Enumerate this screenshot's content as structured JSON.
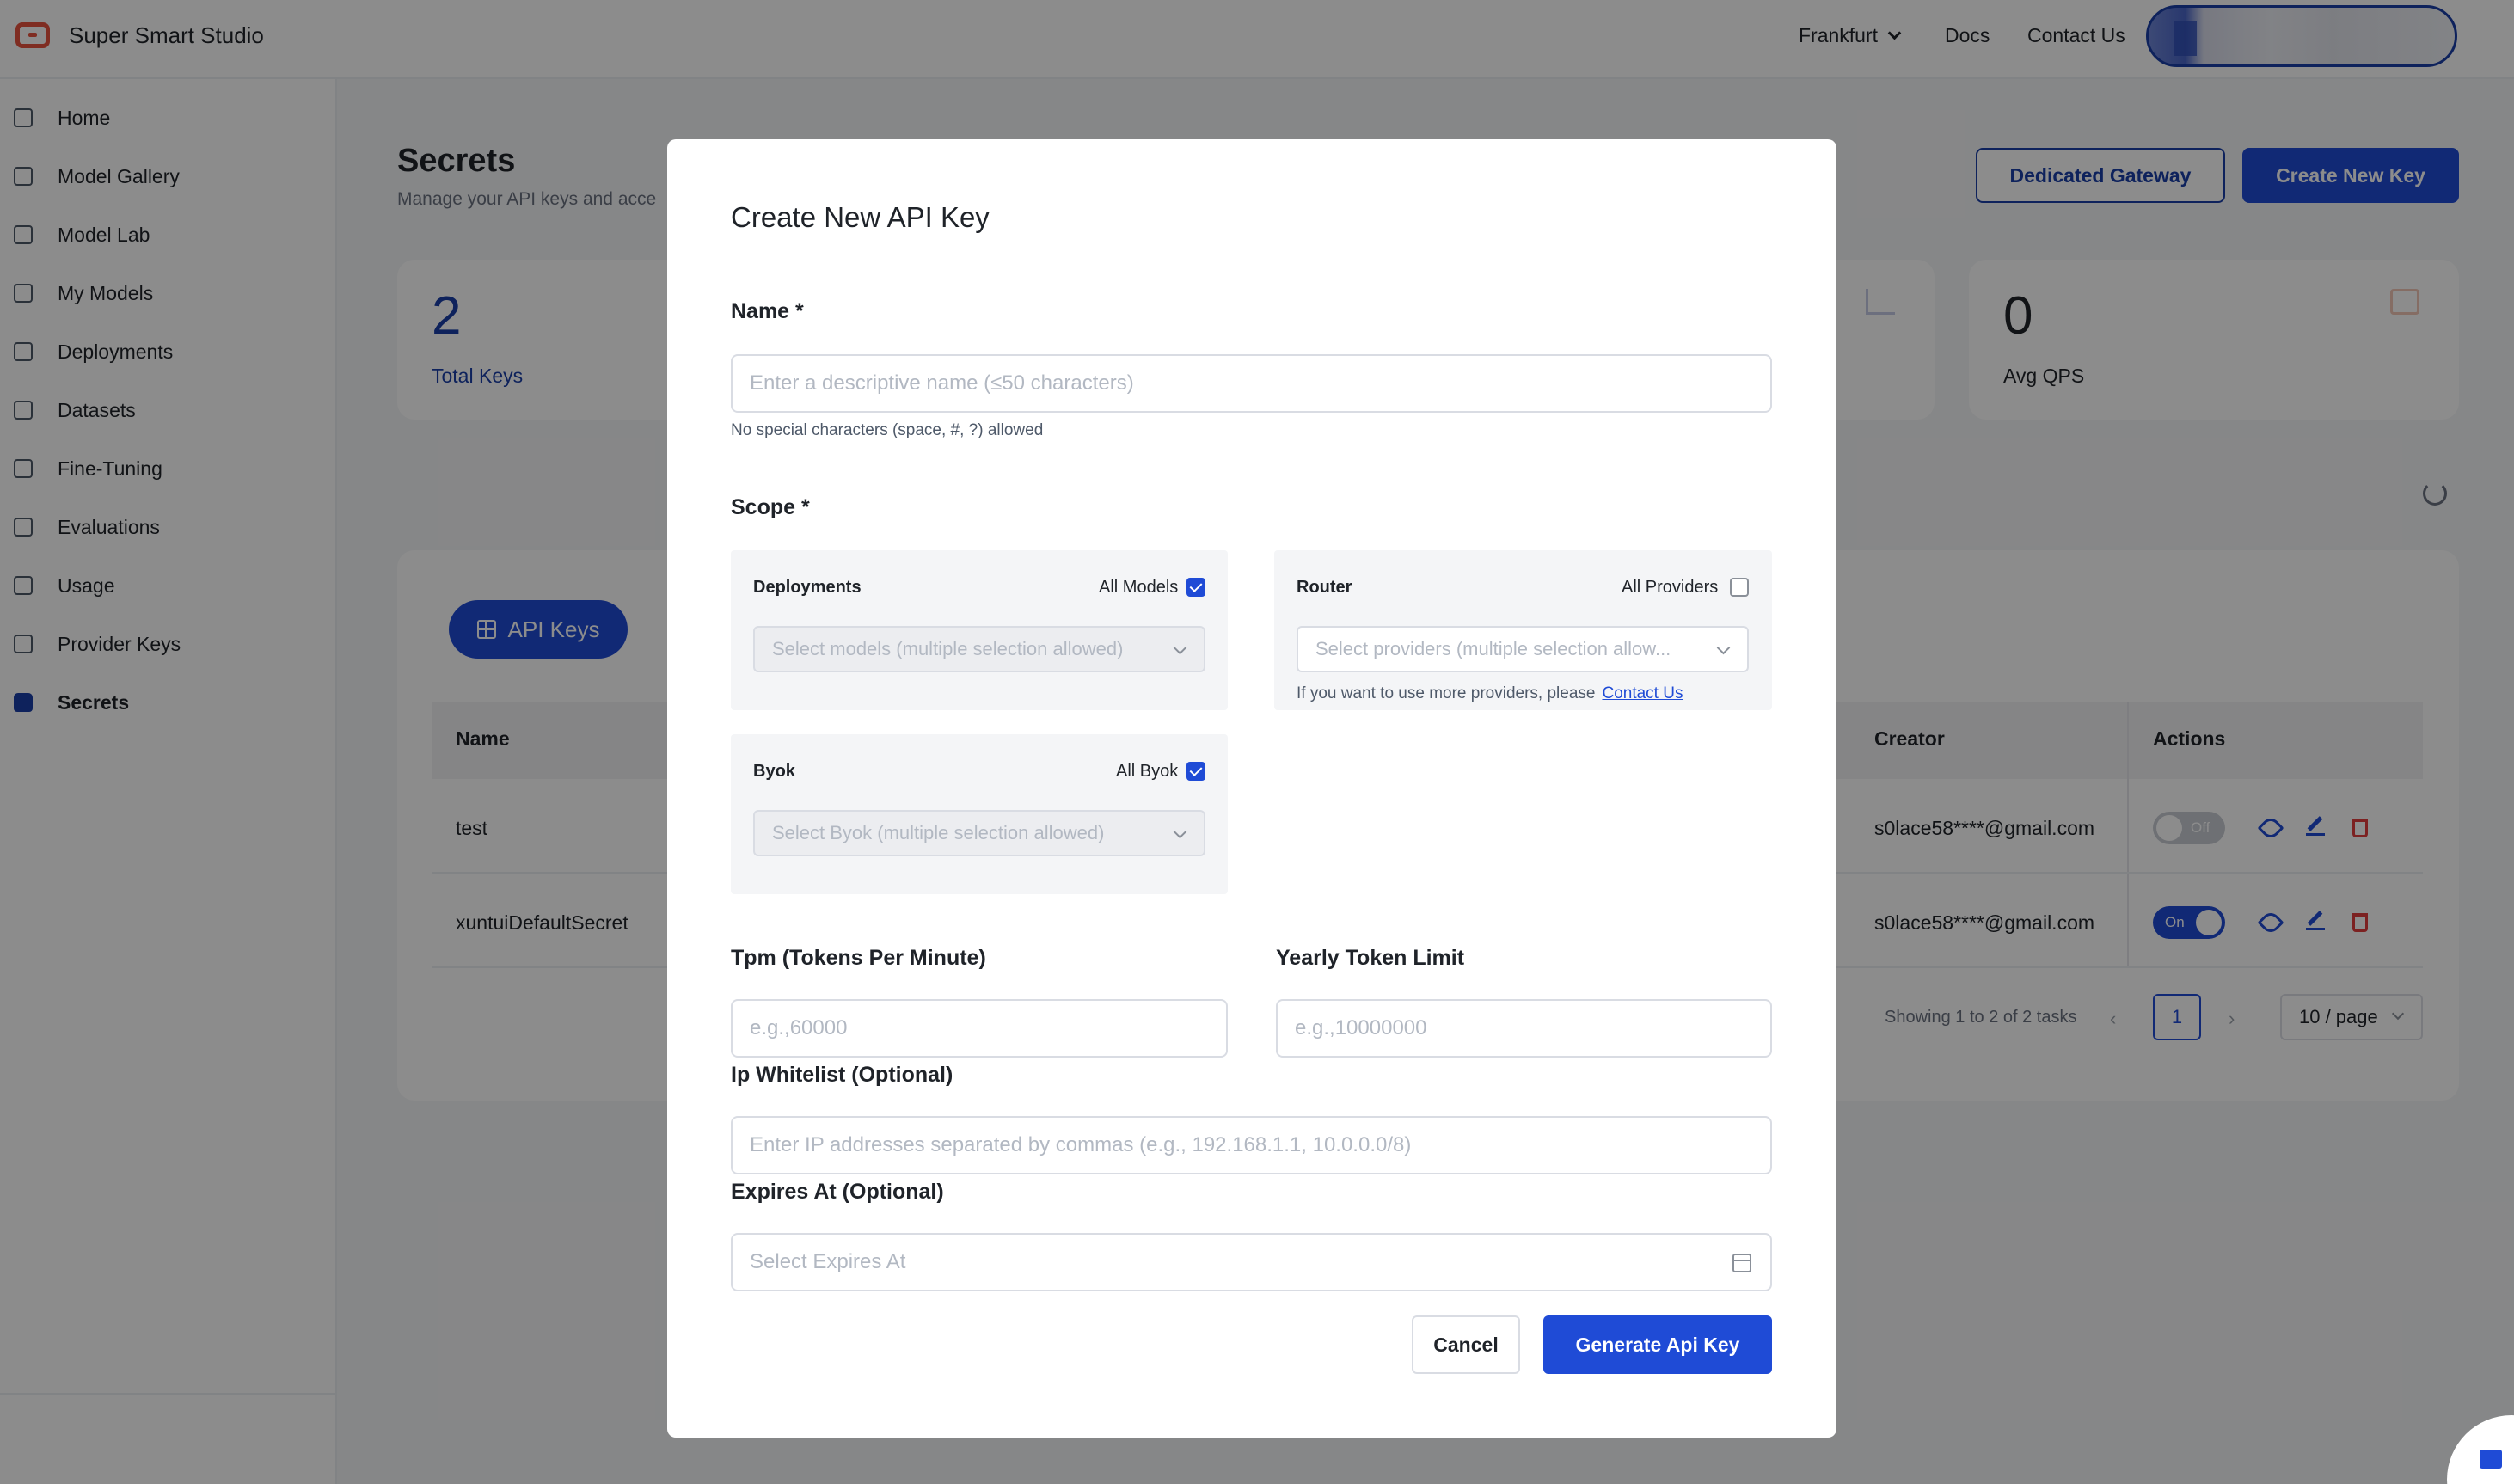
{
  "app": {
    "title": "Super Smart Studio"
  },
  "header": {
    "region": "Frankfurt",
    "docs": "Docs",
    "contact": "Contact Us"
  },
  "sidebar": {
    "items": [
      {
        "label": "Home",
        "icon": "home-icon"
      },
      {
        "label": "Model Gallery",
        "icon": "gallery-icon"
      },
      {
        "label": "Model Lab",
        "icon": "lab-icon"
      },
      {
        "label": "My Models",
        "icon": "models-icon"
      },
      {
        "label": "Deployments",
        "icon": "deployments-icon"
      },
      {
        "label": "Datasets",
        "icon": "datasets-icon"
      },
      {
        "label": "Fine-Tuning",
        "icon": "sliders-icon"
      },
      {
        "label": "Evaluations",
        "icon": "pencil-icon"
      },
      {
        "label": "Usage",
        "icon": "chart-icon"
      },
      {
        "label": "Provider Keys",
        "icon": "key-icon"
      },
      {
        "label": "Secrets",
        "icon": "lock-icon",
        "active": true
      }
    ]
  },
  "page": {
    "title": "Secrets",
    "subtitle": "Manage your API keys and acce",
    "dedicated_gateway": "Dedicated Gateway",
    "create_new_key": "Create New Key",
    "stats": {
      "total_keys_value": "2",
      "total_keys_label": "Total Keys",
      "avg_qps_value": "0",
      "avg_qps_label": "Avg QPS"
    },
    "tab": "API Keys",
    "table": {
      "headers": {
        "name": "Name",
        "creator": "Creator",
        "actions": "Actions"
      },
      "rows": [
        {
          "name": "test",
          "creator": "s0lace58****@gmail.com",
          "toggle": "Off"
        },
        {
          "name": "xuntuiDefaultSecret",
          "creator": "s0lace58****@gmail.com",
          "toggle": "On"
        }
      ]
    },
    "pager": {
      "showing": "Showing 1 to 2 of 2 tasks",
      "current_page": "1",
      "page_size": "10 / page"
    }
  },
  "modal": {
    "title": "Create New API Key",
    "name_label": "Name *",
    "name_placeholder": "Enter a descriptive name (≤50 characters)",
    "name_hint": "No special characters (space, #, ?) allowed",
    "scope_label": "Scope *",
    "deployments": {
      "title": "Deployments",
      "check_label": "All Models",
      "checked": true,
      "placeholder": "Select models (multiple selection allowed)"
    },
    "router": {
      "title": "Router",
      "check_label": "All Providers",
      "checked": false,
      "placeholder": "Select providers (multiple selection allow...",
      "note": "If you want to use more providers, please",
      "note_link": "Contact Us"
    },
    "byok": {
      "title": "Byok",
      "check_label": "All Byok",
      "checked": true,
      "placeholder": "Select Byok (multiple selection allowed)"
    },
    "tpm_label": "Tpm (Tokens Per Minute)",
    "tpm_placeholder": "e.g.,60000",
    "yearly_label": "Yearly Token Limit",
    "yearly_placeholder": "e.g.,10000000",
    "ip_label": "Ip Whitelist (Optional)",
    "ip_placeholder": "Enter IP addresses separated by commas (e.g., 192.168.1.1, 10.0.0.0/8)",
    "expires_label": "Expires At (Optional)",
    "expires_placeholder": "Select Expires At",
    "cancel": "Cancel",
    "generate": "Generate Api Key"
  }
}
